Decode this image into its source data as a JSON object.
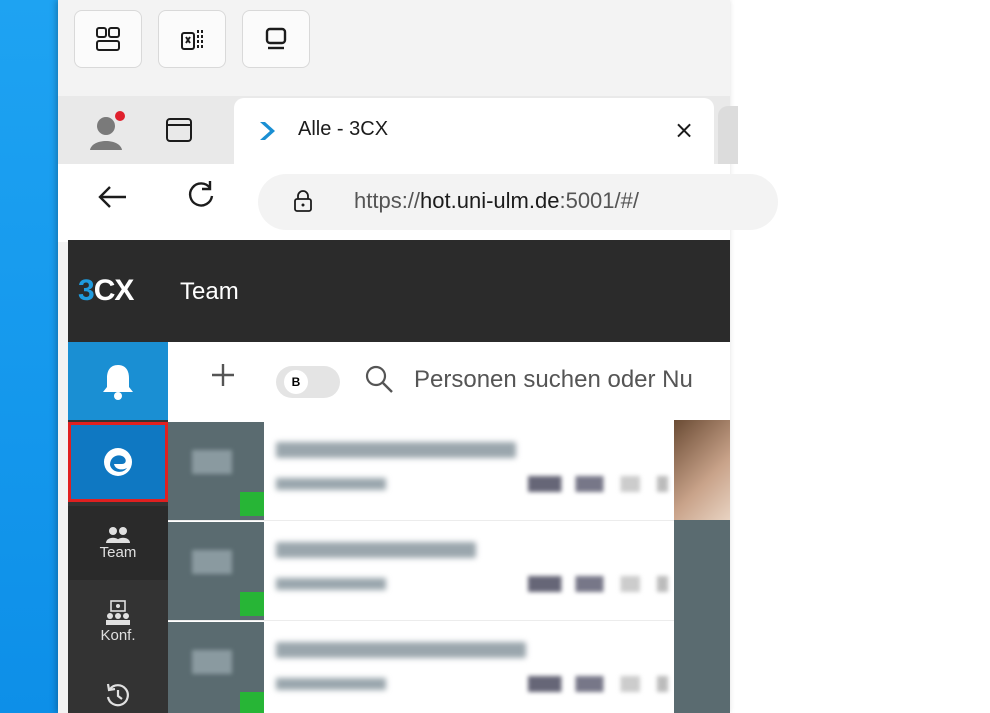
{
  "browser": {
    "tab_title": "Alle - 3CX",
    "tab_close_glyph": "×",
    "url_prefix": "https://",
    "url_host": "hot.uni-ulm.de",
    "url_suffix": ":5001/#/"
  },
  "app": {
    "logo": "3CX",
    "title": "Team",
    "search_placeholder": "Personen suchen oder Nu",
    "toggle_label": "B"
  },
  "sidebar": {
    "items": [
      {
        "label": "Team"
      },
      {
        "label": "Konf."
      }
    ]
  },
  "colors": {
    "accent": "#1a8fd3",
    "presence_online": "#27b536",
    "highlight_border": "#e02020",
    "header_bg": "#2b2b2b"
  }
}
